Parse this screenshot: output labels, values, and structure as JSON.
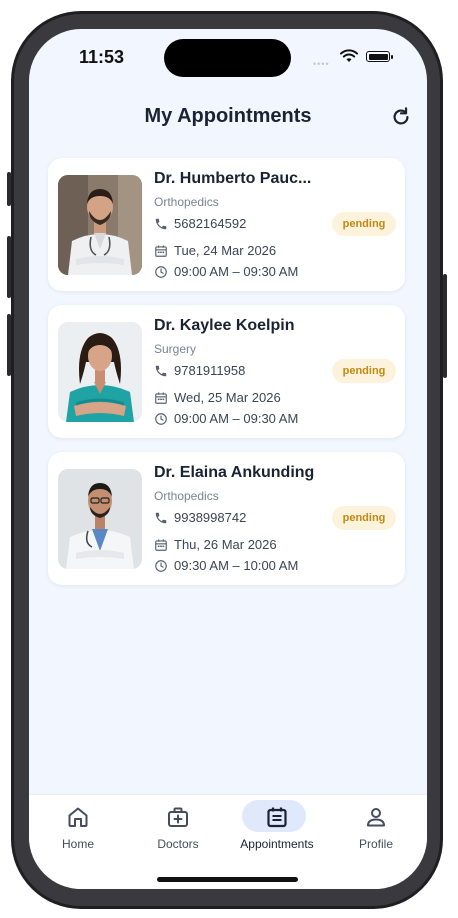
{
  "status_bar": {
    "time": "11:53"
  },
  "header": {
    "title": "My Appointments"
  },
  "appointments": [
    {
      "doctor": "Dr. Humberto Pauc...",
      "specialty": "Orthopedics",
      "phone": "5682164592",
      "date": "Tue, 24 Mar 2026",
      "time": "09:00 AM – 09:30 AM",
      "status": "pending"
    },
    {
      "doctor": "Dr. Kaylee Koelpin",
      "specialty": "Surgery",
      "phone": "9781911958",
      "date": "Wed, 25 Mar 2026",
      "time": "09:00 AM – 09:30 AM",
      "status": "pending"
    },
    {
      "doctor": "Dr. Elaina Ankunding",
      "specialty": "Orthopedics",
      "phone": "9938998742",
      "date": "Thu, 26 Mar 2026",
      "time": "09:30 AM – 10:00 AM",
      "status": "pending"
    }
  ],
  "nav": {
    "active": "Appointments",
    "items": [
      {
        "label": "Home",
        "icon": "home-icon"
      },
      {
        "label": "Doctors",
        "icon": "medical-bag-icon"
      },
      {
        "label": "Appointments",
        "icon": "calendar-icon"
      },
      {
        "label": "Profile",
        "icon": "user-icon"
      }
    ]
  },
  "colors": {
    "background": "#f2f6fe",
    "badge_bg": "#fdf3dc",
    "badge_text": "#c28a11",
    "active_tab": "#dfe9fb"
  }
}
